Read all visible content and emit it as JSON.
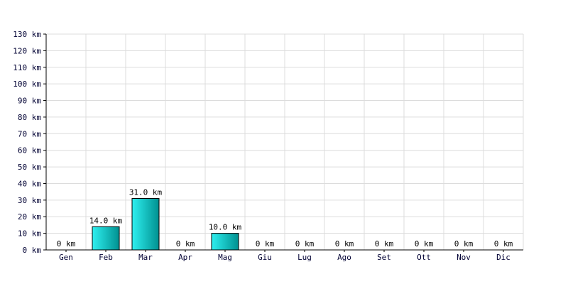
{
  "chart_data": {
    "type": "bar",
    "categories": [
      "Gen",
      "Feb",
      "Mar",
      "Apr",
      "Mag",
      "Giu",
      "Lug",
      "Ago",
      "Set",
      "Ott",
      "Nov",
      "Dic"
    ],
    "values": [
      0,
      14.0,
      31.0,
      0,
      10.0,
      0,
      0,
      0,
      0,
      0,
      0,
      0
    ],
    "data_labels": [
      "0 km",
      "14.0 km",
      "31.0 km",
      "0 km",
      "10.0 km",
      "0 km",
      "0 km",
      "0 km",
      "0 km",
      "0 km",
      "0 km",
      "0 km"
    ],
    "y_ticks": [
      "0 km",
      "10 km",
      "20 km",
      "30 km",
      "40 km",
      "50 km",
      "60 km",
      "70 km",
      "80 km",
      "90 km",
      "100 km",
      "110 km",
      "120 km",
      "130 km"
    ],
    "ylim": [
      0,
      130
    ],
    "y_step": 10,
    "grid": true,
    "bar_color_light": "#2ef0f0",
    "bar_color_dark": "#009090",
    "bar_stroke": "#000000",
    "grid_color": "#dcdcdc",
    "axis_color": "#000000"
  }
}
